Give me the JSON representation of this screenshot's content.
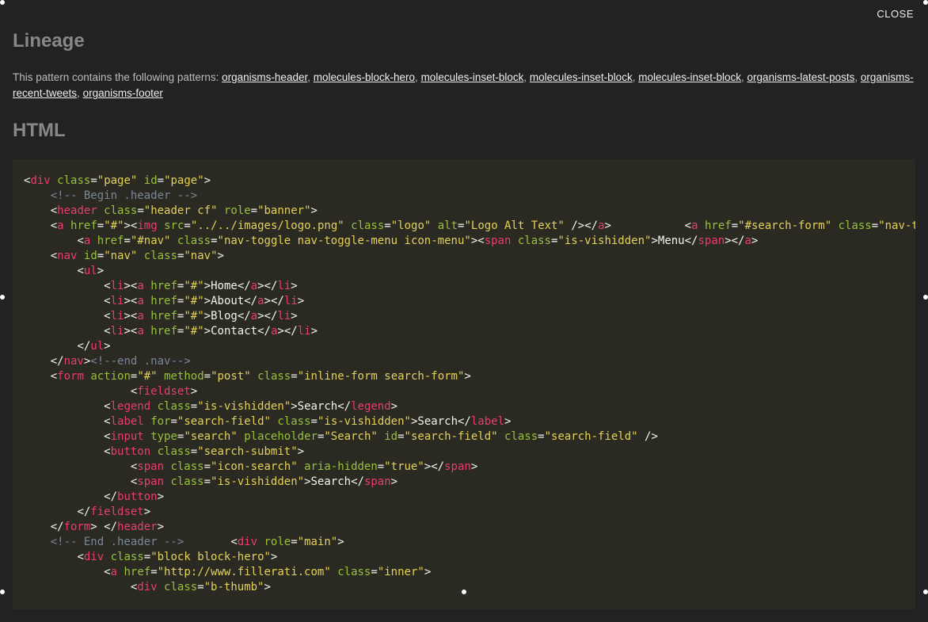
{
  "close_label": "CLOSE",
  "lineage": {
    "title": "Lineage",
    "intro": "This pattern contains the following patterns: ",
    "patterns": [
      "organisms-header",
      "molecules-block-hero",
      "molecules-inset-block",
      "molecules-inset-block",
      "molecules-inset-block",
      "organisms-latest-posts",
      "organisms-recent-tweets",
      "organisms-footer"
    ]
  },
  "html_section_title": "HTML",
  "code": {
    "lines": [
      {
        "indent": 0,
        "type": "tag-open",
        "tag": "div",
        "attrs": [
          [
            "class",
            "page"
          ],
          [
            "id",
            "page"
          ]
        ],
        "self": false
      },
      {
        "indent": 1,
        "type": "comment",
        "text": " Begin .header "
      },
      {
        "indent": 1,
        "type": "tag-open",
        "tag": "header",
        "attrs": [
          [
            "class",
            "header cf"
          ],
          [
            "role",
            "banner"
          ]
        ],
        "self": false
      },
      {
        "indent": 1,
        "type": "raw",
        "segments": [
          [
            "p",
            "<"
          ],
          [
            "t",
            "a"
          ],
          [
            "p",
            " "
          ],
          [
            "at",
            "href"
          ],
          [
            "p",
            "="
          ],
          [
            "s",
            "\"#\""
          ],
          [
            "p",
            ">"
          ],
          [
            "p",
            "<"
          ],
          [
            "t",
            "img"
          ],
          [
            "p",
            " "
          ],
          [
            "at",
            "src"
          ],
          [
            "p",
            "="
          ],
          [
            "s",
            "\"../../images/logo.png\""
          ],
          [
            "p",
            " "
          ],
          [
            "at",
            "class"
          ],
          [
            "p",
            "="
          ],
          [
            "s",
            "\"logo\""
          ],
          [
            "p",
            " "
          ],
          [
            "at",
            "alt"
          ],
          [
            "p",
            "="
          ],
          [
            "s",
            "\"Logo Alt Text\""
          ],
          [
            "p",
            " />"
          ],
          [
            "p",
            "</"
          ],
          [
            "t",
            "a"
          ],
          [
            "p",
            ">"
          ],
          [
            "p",
            "           "
          ],
          [
            "p",
            "<"
          ],
          [
            "t",
            "a"
          ],
          [
            "p",
            " "
          ],
          [
            "at",
            "href"
          ],
          [
            "p",
            "="
          ],
          [
            "s",
            "\"#search-form\""
          ],
          [
            "p",
            " "
          ],
          [
            "at",
            "class"
          ],
          [
            "p",
            "="
          ],
          [
            "s",
            "\"nav-toggle nav-"
          ]
        ]
      },
      {
        "indent": 2,
        "type": "raw",
        "segments": [
          [
            "p",
            "<"
          ],
          [
            "t",
            "a"
          ],
          [
            "p",
            " "
          ],
          [
            "at",
            "href"
          ],
          [
            "p",
            "="
          ],
          [
            "s",
            "\"#nav\""
          ],
          [
            "p",
            " "
          ],
          [
            "at",
            "class"
          ],
          [
            "p",
            "="
          ],
          [
            "s",
            "\"nav-toggle nav-toggle-menu icon-menu\""
          ],
          [
            "p",
            ">"
          ],
          [
            "p",
            "<"
          ],
          [
            "t",
            "span"
          ],
          [
            "p",
            " "
          ],
          [
            "at",
            "class"
          ],
          [
            "p",
            "="
          ],
          [
            "s",
            "\"is-vishidden\""
          ],
          [
            "p",
            ">"
          ],
          [
            "tx",
            "Menu"
          ],
          [
            "p",
            "</"
          ],
          [
            "t",
            "span"
          ],
          [
            "p",
            ">"
          ],
          [
            "p",
            "</"
          ],
          [
            "t",
            "a"
          ],
          [
            "p",
            ">"
          ]
        ]
      },
      {
        "indent": 1,
        "type": "tag-open",
        "tag": "nav",
        "attrs": [
          [
            "id",
            "nav"
          ],
          [
            "class",
            "nav"
          ]
        ],
        "self": false
      },
      {
        "indent": 2,
        "type": "tag-open",
        "tag": "ul",
        "attrs": [],
        "self": false
      },
      {
        "indent": 3,
        "type": "li-link",
        "text": "Home"
      },
      {
        "indent": 3,
        "type": "li-link",
        "text": "About"
      },
      {
        "indent": 3,
        "type": "li-link",
        "text": "Blog"
      },
      {
        "indent": 3,
        "type": "li-link",
        "text": "Contact"
      },
      {
        "indent": 2,
        "type": "tag-close",
        "tag": "ul"
      },
      {
        "indent": 1,
        "type": "raw",
        "segments": [
          [
            "p",
            "</"
          ],
          [
            "t",
            "nav"
          ],
          [
            "p",
            ">"
          ],
          [
            "cm",
            "<!--end .nav-->"
          ]
        ]
      },
      {
        "indent": 1,
        "type": "tag-open",
        "tag": "form",
        "attrs": [
          [
            "action",
            "#"
          ],
          [
            "method",
            "post"
          ],
          [
            "class",
            "inline-form search-form"
          ]
        ],
        "self": false
      },
      {
        "indent": 4,
        "type": "tag-open",
        "tag": "fieldset",
        "attrs": [],
        "self": false
      },
      {
        "indent": 3,
        "type": "raw",
        "segments": [
          [
            "p",
            "<"
          ],
          [
            "t",
            "legend"
          ],
          [
            "p",
            " "
          ],
          [
            "at",
            "class"
          ],
          [
            "p",
            "="
          ],
          [
            "s",
            "\"is-vishidden\""
          ],
          [
            "p",
            ">"
          ],
          [
            "tx",
            "Search"
          ],
          [
            "p",
            "</"
          ],
          [
            "t",
            "legend"
          ],
          [
            "p",
            ">"
          ]
        ]
      },
      {
        "indent": 3,
        "type": "raw",
        "segments": [
          [
            "p",
            "<"
          ],
          [
            "t",
            "label"
          ],
          [
            "p",
            " "
          ],
          [
            "at",
            "for"
          ],
          [
            "p",
            "="
          ],
          [
            "s",
            "\"search-field\""
          ],
          [
            "p",
            " "
          ],
          [
            "at",
            "class"
          ],
          [
            "p",
            "="
          ],
          [
            "s",
            "\"is-vishidden\""
          ],
          [
            "p",
            ">"
          ],
          [
            "tx",
            "Search"
          ],
          [
            "p",
            "</"
          ],
          [
            "t",
            "label"
          ],
          [
            "p",
            ">"
          ]
        ]
      },
      {
        "indent": 3,
        "type": "tag-open",
        "tag": "input",
        "attrs": [
          [
            "type",
            "search"
          ],
          [
            "placeholder",
            "Search"
          ],
          [
            "id",
            "search-field"
          ],
          [
            "class",
            "search-field"
          ]
        ],
        "self": true
      },
      {
        "indent": 3,
        "type": "tag-open",
        "tag": "button",
        "attrs": [
          [
            "class",
            "search-submit"
          ]
        ],
        "self": false
      },
      {
        "indent": 4,
        "type": "raw",
        "segments": [
          [
            "p",
            "<"
          ],
          [
            "t",
            "span"
          ],
          [
            "p",
            " "
          ],
          [
            "at",
            "class"
          ],
          [
            "p",
            "="
          ],
          [
            "s",
            "\"icon-search\""
          ],
          [
            "p",
            " "
          ],
          [
            "at",
            "aria-hidden"
          ],
          [
            "p",
            "="
          ],
          [
            "s",
            "\"true\""
          ],
          [
            "p",
            ">"
          ],
          [
            "p",
            "</"
          ],
          [
            "t",
            "span"
          ],
          [
            "p",
            ">"
          ]
        ]
      },
      {
        "indent": 4,
        "type": "raw",
        "segments": [
          [
            "p",
            "<"
          ],
          [
            "t",
            "span"
          ],
          [
            "p",
            " "
          ],
          [
            "at",
            "class"
          ],
          [
            "p",
            "="
          ],
          [
            "s",
            "\"is-vishidden\""
          ],
          [
            "p",
            ">"
          ],
          [
            "tx",
            "Search"
          ],
          [
            "p",
            "</"
          ],
          [
            "t",
            "span"
          ],
          [
            "p",
            ">"
          ]
        ]
      },
      {
        "indent": 3,
        "type": "tag-close",
        "tag": "button"
      },
      {
        "indent": 2,
        "type": "tag-close",
        "tag": "fieldset"
      },
      {
        "indent": 1,
        "type": "raw",
        "segments": [
          [
            "p",
            "</"
          ],
          [
            "t",
            "form"
          ],
          [
            "p",
            "> "
          ],
          [
            "p",
            "</"
          ],
          [
            "t",
            "header"
          ],
          [
            "p",
            ">"
          ]
        ]
      },
      {
        "indent": 1,
        "type": "raw",
        "segments": [
          [
            "cm",
            "<!-- End .header -->"
          ],
          [
            "p",
            "       "
          ],
          [
            "p",
            "<"
          ],
          [
            "t",
            "div"
          ],
          [
            "p",
            " "
          ],
          [
            "at",
            "role"
          ],
          [
            "p",
            "="
          ],
          [
            "s",
            "\"main\""
          ],
          [
            "p",
            ">"
          ]
        ]
      },
      {
        "indent": 2,
        "type": "tag-open",
        "tag": "div",
        "attrs": [
          [
            "class",
            "block block-hero"
          ]
        ],
        "self": false
      },
      {
        "indent": 3,
        "type": "tag-open",
        "tag": "a",
        "attrs": [
          [
            "href",
            "http://www.fillerati.com"
          ],
          [
            "class",
            "inner"
          ]
        ],
        "self": false
      },
      {
        "indent": 4,
        "type": "tag-open",
        "tag": "div",
        "attrs": [
          [
            "class",
            "b-thumb"
          ]
        ],
        "self": false
      }
    ]
  }
}
